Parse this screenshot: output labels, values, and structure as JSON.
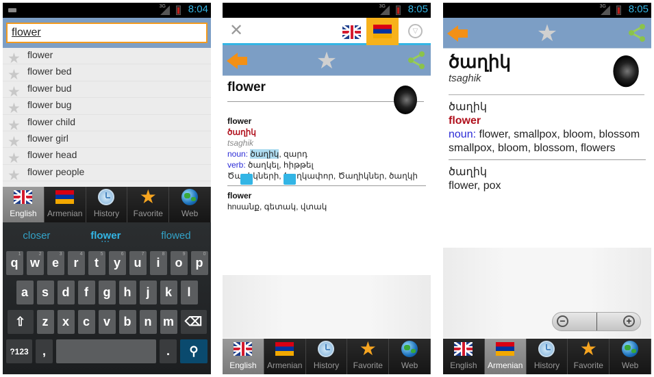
{
  "status": {
    "p1_time": "8:04",
    "p2_time": "8:05",
    "p3_time": "8:05",
    "network": "3G"
  },
  "search": {
    "value": "flower"
  },
  "suggestions": [
    "flower",
    "flower bed",
    "flower bud",
    "flower bug",
    "flower child",
    "flower girl",
    "flower head",
    "flower people"
  ],
  "tabs": [
    {
      "label": "English",
      "icon": "uk-flag-icon"
    },
    {
      "label": "Armenian",
      "icon": "armenia-flag-icon"
    },
    {
      "label": "History",
      "icon": "clock-icon"
    },
    {
      "label": "Favorite",
      "icon": "star-icon"
    },
    {
      "label": "Web",
      "icon": "globe-icon"
    }
  ],
  "keyboard": {
    "suggestions": [
      "closer",
      "flower",
      "flowed"
    ],
    "row1": [
      "q",
      "w",
      "e",
      "r",
      "t",
      "y",
      "u",
      "i",
      "o",
      "p"
    ],
    "row1_nums": [
      "1",
      "2",
      "3",
      "4",
      "5",
      "6",
      "7",
      "8",
      "9",
      "0"
    ],
    "row2": [
      "a",
      "s",
      "d",
      "f",
      "g",
      "h",
      "j",
      "k",
      "l"
    ],
    "row3": [
      "z",
      "x",
      "c",
      "v",
      "b",
      "n",
      "m"
    ],
    "shift": "⇧",
    "backspace": "⌫",
    "symbols": "?123",
    "comma": ",",
    "period": ".",
    "search": "⚲"
  },
  "entry_en": {
    "headword": "flower",
    "sections": [
      {
        "word": "flower",
        "translation": "ծաղիկ",
        "transliteration": "tsaghik",
        "noun_label": "noun:",
        "noun_highlight": "ծաղիկ",
        "noun_rest": ", զարդ",
        "verb_label": "verb:",
        "verb_text": " ծաղկել, հիթթել",
        "extra": "Ծաղիկների, ծաղկափոր, Ծաղիկներ, ծաղկի"
      },
      {
        "word": "flower",
        "text": "hnuանք, գետակ, վտակ"
      }
    ]
  },
  "entry_hy": {
    "headword": "ծաղիկ",
    "transliteration": "tsaghik",
    "sections": [
      {
        "word": "ծաղիկ",
        "translation": "flower",
        "noun_label": "noun:",
        "noun_text": " flower, smallpox, bloom, blossom",
        "extra": "smallpox, bloom, blossom, flowers"
      },
      {
        "word": "ծաղիկ",
        "text": "flower, pox"
      }
    ]
  },
  "zoom": {
    "out": "−",
    "in": "+"
  },
  "langbar": {
    "close": "✕",
    "options": "▽"
  }
}
